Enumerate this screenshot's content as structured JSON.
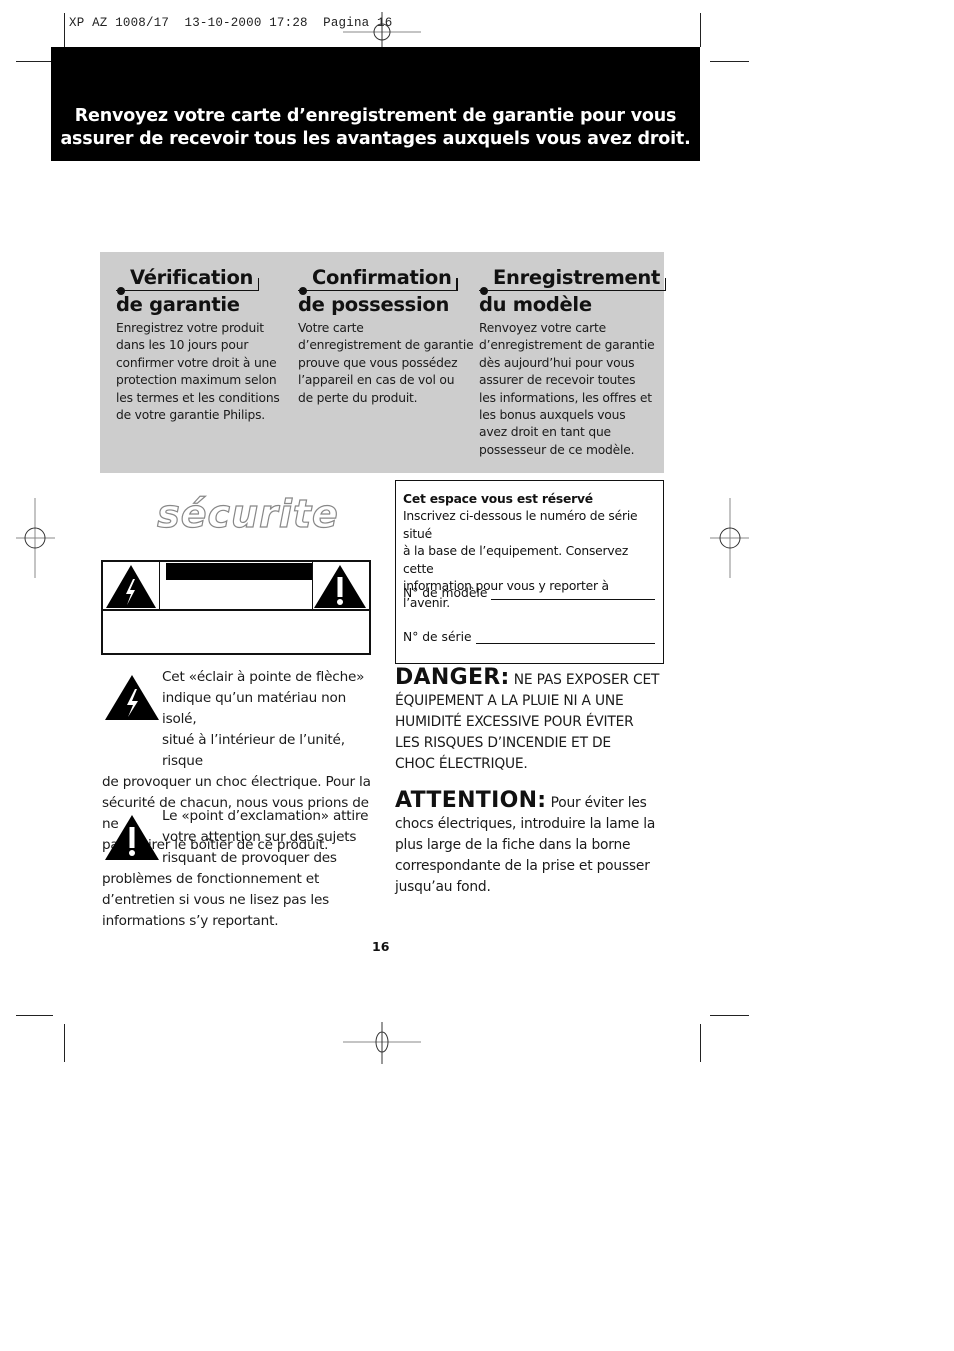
{
  "slug": "XP AZ 1008/17  13-10-2000 17:28  Pagina 16",
  "banner": {
    "line1": "Renvoyez votre carte d’enregistrement de garantie pour vous",
    "line2": "assurer de recevoir tous les avantages auxquels vous avez droit."
  },
  "columns": [
    {
      "title_line1": "Vérification",
      "title_line2": "de garantie",
      "body": [
        "Enregistrez votre produit",
        "dans les 10 jours pour",
        "confirmer votre droit à une",
        "protection maximum selon",
        "les termes et les conditions",
        "de votre garantie Philips."
      ]
    },
    {
      "title_line1": "Confirmation",
      "title_line2": "de possession",
      "body": [
        "Votre carte",
        "d’enregistrement de garantie",
        "prouve que vous possédez",
        "l’appareil en cas de vol ou",
        "de perte du produit."
      ]
    },
    {
      "title_line1": "Enregistrement",
      "title_line2": "du modèle",
      "body": [
        "Renvoyez votre carte",
        "d’enregistrement de garantie",
        "dès aujourd’hui pour vous",
        "assurer de recevoir toutes",
        "les informations, les offres et",
        "les bonus auxquels vous",
        "avez droit en tant que",
        "possesseur de ce modèle."
      ]
    }
  ],
  "securite_title": "sécurite",
  "lightning_note": {
    "lines": [
      "Cet «éclair à pointe de flèche»",
      "indique qu’un matériau non isolé,",
      "situé à l’intérieur de l’unité, risque",
      "de provoquer un choc électrique. Pour la",
      "sécurité de chacun, nous vous prions de ne",
      "pas retirer le boîtier de ce produit."
    ]
  },
  "exclamation_note": {
    "lines": [
      "Le «point d’exclamation» attire",
      "votre attention sur des sujets",
      "risquant de provoquer des",
      "problèmes de fonctionnement et",
      "d’entretien si vous ne lisez pas les",
      "informations s’y reportant."
    ]
  },
  "reserve_box": {
    "title": "Cet espace vous est réservé",
    "lines": [
      "Inscrivez ci-dessous le numéro de série situé",
      "à la base de l’equipement. Conservez cette",
      "information pour vous y reporter à l’avenir."
    ],
    "model_label": "N° de modèle",
    "serial_label": "N° de série"
  },
  "danger": {
    "label": "DANGER:",
    "first": " NE PAS EXPOSER CET",
    "lines": [
      "ÉQUIPEMENT A LA PLUIE NI A UNE",
      "HUMIDITÉ EXCESSIVE POUR ÉVITER",
      "LES RISQUES D’INCENDIE ET DE",
      "CHOC ÉLECTRIQUE."
    ]
  },
  "attention": {
    "label": "ATTENTION:",
    "first": " Pour éviter les",
    "lines": [
      "chocs électriques, introduire la lame la",
      "plus large de la fiche dans la borne",
      "correspondante de la prise et pousser",
      "jusqu’au fond."
    ]
  },
  "page_number": "16"
}
